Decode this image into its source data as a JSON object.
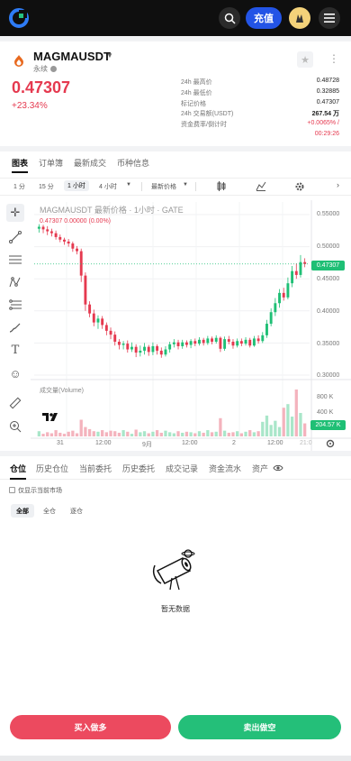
{
  "header": {
    "deposit_label": "充值"
  },
  "pair": {
    "name": "MAGMAUSDT",
    "type": "永续",
    "last_price": "0.47307",
    "change": "+23.34%",
    "stats": [
      {
        "label": "24h 最高价",
        "value": "0.48728"
      },
      {
        "label": "24h 最低价",
        "value": "0.32885"
      },
      {
        "label": "标记价格",
        "value": "0.47307"
      },
      {
        "label": "24h 交易额(USDT)",
        "value": "267.54 万"
      },
      {
        "label": "资金费率/倒计时",
        "value": "+0.0065% /"
      },
      {
        "label": "",
        "value": "00:29:26"
      }
    ]
  },
  "main_tabs": [
    "图表",
    "订单簿",
    "最新成交",
    "币种信息"
  ],
  "chart_toolbar": {
    "intervals": [
      "1 分",
      "15 分",
      "1 小时",
      "4 小时"
    ],
    "active_interval": "1 小时",
    "price_type": "最新价格"
  },
  "chart_data": {
    "type": "candlestick",
    "title": "MAGMAUSDT 最新价格 · 1小时 · GATE",
    "subtitle": "0.47307  0.00000 (0.00%)",
    "y_ticks": [
      "0.55000",
      "0.50000",
      "0.45000",
      "0.40000",
      "0.35000",
      "0.30000"
    ],
    "ylim": [
      0.3,
      0.55
    ],
    "last_price_tag": "0.47307",
    "volume_title": "成交量(Volume)",
    "volume_ticks": [
      "800 K",
      "400 K"
    ],
    "volume_tag": "204.57 K",
    "x_ticks": [
      "31",
      "12:00",
      "9月",
      "12:00",
      "2",
      "12:00",
      "21:0"
    ],
    "candles": [
      {
        "o": 0.528,
        "c": 0.531,
        "h": 0.535,
        "l": 0.522
      },
      {
        "o": 0.531,
        "c": 0.527,
        "h": 0.534,
        "l": 0.521
      },
      {
        "o": 0.527,
        "c": 0.524,
        "h": 0.532,
        "l": 0.518
      },
      {
        "o": 0.524,
        "c": 0.521,
        "h": 0.528,
        "l": 0.516
      },
      {
        "o": 0.521,
        "c": 0.515,
        "h": 0.525,
        "l": 0.511
      },
      {
        "o": 0.515,
        "c": 0.511,
        "h": 0.519,
        "l": 0.507
      },
      {
        "o": 0.511,
        "c": 0.508,
        "h": 0.514,
        "l": 0.503
      },
      {
        "o": 0.508,
        "c": 0.505,
        "h": 0.512,
        "l": 0.5
      },
      {
        "o": 0.505,
        "c": 0.497,
        "h": 0.508,
        "l": 0.492
      },
      {
        "o": 0.497,
        "c": 0.493,
        "h": 0.501,
        "l": 0.488
      },
      {
        "o": 0.493,
        "c": 0.455,
        "h": 0.497,
        "l": 0.445
      },
      {
        "o": 0.455,
        "c": 0.41,
        "h": 0.46,
        "l": 0.4
      },
      {
        "o": 0.41,
        "c": 0.396,
        "h": 0.415,
        "l": 0.39
      },
      {
        "o": 0.396,
        "c": 0.382,
        "h": 0.402,
        "l": 0.376
      },
      {
        "o": 0.382,
        "c": 0.388,
        "h": 0.393,
        "l": 0.372
      },
      {
        "o": 0.388,
        "c": 0.378,
        "h": 0.392,
        "l": 0.372
      },
      {
        "o": 0.378,
        "c": 0.369,
        "h": 0.382,
        "l": 0.362
      },
      {
        "o": 0.369,
        "c": 0.363,
        "h": 0.374,
        "l": 0.356
      },
      {
        "o": 0.363,
        "c": 0.352,
        "h": 0.368,
        "l": 0.346
      },
      {
        "o": 0.352,
        "c": 0.347,
        "h": 0.356,
        "l": 0.34
      },
      {
        "o": 0.347,
        "c": 0.349,
        "h": 0.353,
        "l": 0.34
      },
      {
        "o": 0.349,
        "c": 0.34,
        "h": 0.354,
        "l": 0.335
      },
      {
        "o": 0.34,
        "c": 0.344,
        "h": 0.351,
        "l": 0.336
      },
      {
        "o": 0.344,
        "c": 0.335,
        "h": 0.348,
        "l": 0.328
      },
      {
        "o": 0.335,
        "c": 0.338,
        "h": 0.346,
        "l": 0.329
      },
      {
        "o": 0.338,
        "c": 0.344,
        "h": 0.35,
        "l": 0.332
      },
      {
        "o": 0.344,
        "c": 0.336,
        "h": 0.347,
        "l": 0.33
      },
      {
        "o": 0.336,
        "c": 0.345,
        "h": 0.351,
        "l": 0.331
      },
      {
        "o": 0.345,
        "c": 0.338,
        "h": 0.348,
        "l": 0.332
      },
      {
        "o": 0.338,
        "c": 0.332,
        "h": 0.343,
        "l": 0.327
      },
      {
        "o": 0.332,
        "c": 0.34,
        "h": 0.345,
        "l": 0.329
      },
      {
        "o": 0.34,
        "c": 0.348,
        "h": 0.352,
        "l": 0.335
      },
      {
        "o": 0.348,
        "c": 0.351,
        "h": 0.356,
        "l": 0.343
      },
      {
        "o": 0.351,
        "c": 0.345,
        "h": 0.355,
        "l": 0.34
      },
      {
        "o": 0.345,
        "c": 0.351,
        "h": 0.355,
        "l": 0.341
      },
      {
        "o": 0.351,
        "c": 0.347,
        "h": 0.354,
        "l": 0.343
      },
      {
        "o": 0.347,
        "c": 0.353,
        "h": 0.356,
        "l": 0.342
      },
      {
        "o": 0.353,
        "c": 0.349,
        "h": 0.357,
        "l": 0.345
      },
      {
        "o": 0.349,
        "c": 0.355,
        "h": 0.359,
        "l": 0.346
      },
      {
        "o": 0.355,
        "c": 0.35,
        "h": 0.358,
        "l": 0.346
      },
      {
        "o": 0.35,
        "c": 0.357,
        "h": 0.361,
        "l": 0.347
      },
      {
        "o": 0.357,
        "c": 0.352,
        "h": 0.36,
        "l": 0.348
      },
      {
        "o": 0.352,
        "c": 0.358,
        "h": 0.362,
        "l": 0.349
      },
      {
        "o": 0.358,
        "c": 0.341,
        "h": 0.36,
        "l": 0.336
      },
      {
        "o": 0.341,
        "c": 0.356,
        "h": 0.36,
        "l": 0.338
      },
      {
        "o": 0.356,
        "c": 0.352,
        "h": 0.361,
        "l": 0.348
      },
      {
        "o": 0.352,
        "c": 0.346,
        "h": 0.356,
        "l": 0.341
      },
      {
        "o": 0.346,
        "c": 0.353,
        "h": 0.357,
        "l": 0.343
      },
      {
        "o": 0.353,
        "c": 0.349,
        "h": 0.357,
        "l": 0.345
      },
      {
        "o": 0.349,
        "c": 0.355,
        "h": 0.359,
        "l": 0.346
      },
      {
        "o": 0.355,
        "c": 0.346,
        "h": 0.358,
        "l": 0.343
      },
      {
        "o": 0.346,
        "c": 0.357,
        "h": 0.361,
        "l": 0.344
      },
      {
        "o": 0.357,
        "c": 0.353,
        "h": 0.362,
        "l": 0.349
      },
      {
        "o": 0.353,
        "c": 0.362,
        "h": 0.367,
        "l": 0.35
      },
      {
        "o": 0.362,
        "c": 0.38,
        "h": 0.386,
        "l": 0.358
      },
      {
        "o": 0.38,
        "c": 0.398,
        "h": 0.404,
        "l": 0.376
      },
      {
        "o": 0.398,
        "c": 0.412,
        "h": 0.42,
        "l": 0.392
      },
      {
        "o": 0.412,
        "c": 0.428,
        "h": 0.434,
        "l": 0.405
      },
      {
        "o": 0.428,
        "c": 0.421,
        "h": 0.436,
        "l": 0.416
      },
      {
        "o": 0.421,
        "c": 0.443,
        "h": 0.452,
        "l": 0.418
      },
      {
        "o": 0.443,
        "c": 0.462,
        "h": 0.47,
        "l": 0.437
      },
      {
        "o": 0.462,
        "c": 0.456,
        "h": 0.474,
        "l": 0.45
      },
      {
        "o": 0.456,
        "c": 0.476,
        "h": 0.487,
        "l": 0.452
      },
      {
        "o": 0.476,
        "c": 0.473,
        "h": 0.482,
        "l": 0.468
      }
    ],
    "volumes": [
      0.1,
      0.05,
      0.08,
      0.06,
      0.12,
      0.07,
      0.05,
      0.09,
      0.11,
      0.06,
      0.32,
      0.18,
      0.14,
      0.1,
      0.09,
      0.12,
      0.08,
      0.11,
      0.1,
      0.07,
      0.12,
      0.09,
      0.05,
      0.13,
      0.08,
      0.1,
      0.06,
      0.09,
      0.12,
      0.07,
      0.11,
      0.08,
      0.06,
      0.1,
      0.07,
      0.09,
      0.08,
      0.06,
      0.1,
      0.07,
      0.12,
      0.08,
      0.09,
      0.35,
      0.11,
      0.07,
      0.08,
      0.1,
      0.06,
      0.09,
      0.12,
      0.08,
      0.1,
      0.28,
      0.4,
      0.22,
      0.3,
      0.18,
      0.55,
      0.62,
      0.38,
      0.9,
      0.45,
      0.25
    ]
  },
  "positions_tabs": [
    "仓位",
    "历史仓位",
    "当前委托",
    "历史委托",
    "成交记录",
    "资金流水",
    "资产"
  ],
  "only_current_market": "仅显示当前市场",
  "filters": [
    "全部",
    "全仓",
    "逐仓"
  ],
  "empty_text": "暂无数据",
  "actions": {
    "buy": "买入做多",
    "sell": "卖出做空"
  },
  "colors": {
    "up": "#1fbf75",
    "down": "#e5394f",
    "accent": "#2354e6"
  }
}
